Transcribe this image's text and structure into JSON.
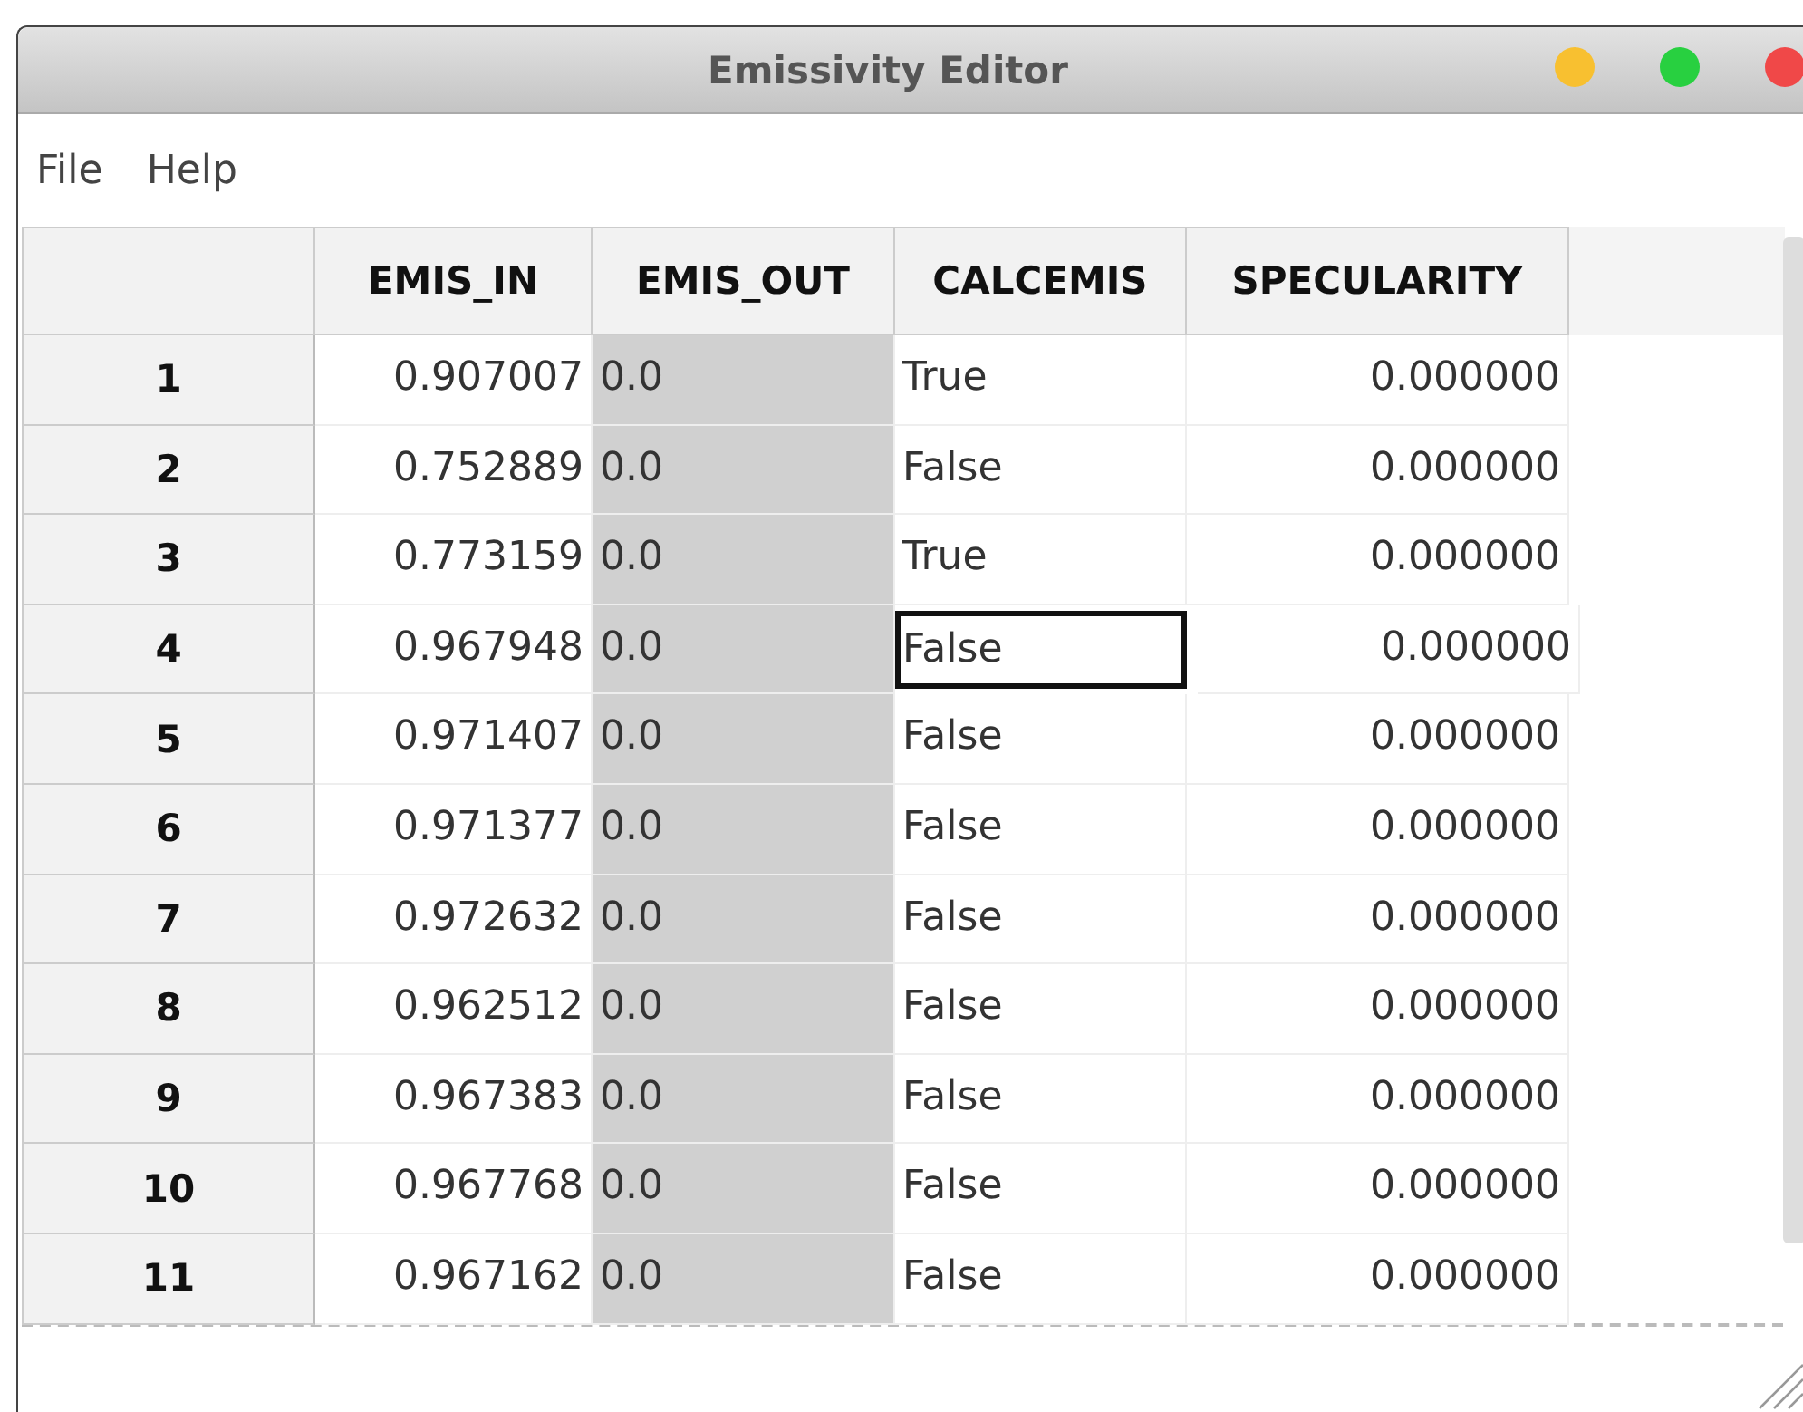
{
  "window": {
    "title": "Emissivity Editor"
  },
  "menu": [
    "File",
    "Help"
  ],
  "table": {
    "columns": [
      {
        "label": "EMIS_IN",
        "read_only": false
      },
      {
        "label": "EMIS_OUT",
        "read_only": true
      },
      {
        "label": "CALCEMIS",
        "read_only": false
      },
      {
        "label": "SPECULARITY",
        "read_only": false
      }
    ],
    "rows": [
      {
        "header": "1",
        "cells": [
          {
            "text": "0.907007",
            "selected": false
          },
          {
            "text": "0.0",
            "selected": false
          },
          {
            "text": "True",
            "selected": false
          },
          {
            "text": "0.000000",
            "selected": false
          }
        ]
      },
      {
        "header": "2",
        "cells": [
          {
            "text": "0.752889",
            "selected": false
          },
          {
            "text": "0.0",
            "selected": false
          },
          {
            "text": "False",
            "selected": false
          },
          {
            "text": "0.000000",
            "selected": false
          }
        ]
      },
      {
        "header": "3",
        "cells": [
          {
            "text": "0.773159",
            "selected": false
          },
          {
            "text": "0.0",
            "selected": false
          },
          {
            "text": "True",
            "selected": false
          },
          {
            "text": "0.000000",
            "selected": false
          }
        ]
      },
      {
        "header": "4",
        "cells": [
          {
            "text": "0.967948",
            "selected": false
          },
          {
            "text": "0.0",
            "selected": false
          },
          {
            "text": "False",
            "selected": true
          },
          {
            "text": "0.000000",
            "selected": false
          }
        ]
      },
      {
        "header": "5",
        "cells": [
          {
            "text": "0.971407",
            "selected": false
          },
          {
            "text": "0.0",
            "selected": false
          },
          {
            "text": "False",
            "selected": false
          },
          {
            "text": "0.000000",
            "selected": false
          }
        ]
      },
      {
        "header": "6",
        "cells": [
          {
            "text": "0.971377",
            "selected": false
          },
          {
            "text": "0.0",
            "selected": false
          },
          {
            "text": "False",
            "selected": false
          },
          {
            "text": "0.000000",
            "selected": false
          }
        ]
      },
      {
        "header": "7",
        "cells": [
          {
            "text": "0.972632",
            "selected": false
          },
          {
            "text": "0.0",
            "selected": false
          },
          {
            "text": "False",
            "selected": false
          },
          {
            "text": "0.000000",
            "selected": false
          }
        ]
      },
      {
        "header": "8",
        "cells": [
          {
            "text": "0.962512",
            "selected": false
          },
          {
            "text": "0.0",
            "selected": false
          },
          {
            "text": "False",
            "selected": false
          },
          {
            "text": "0.000000",
            "selected": false
          }
        ]
      },
      {
        "header": "9",
        "cells": [
          {
            "text": "0.967383",
            "selected": false
          },
          {
            "text": "0.0",
            "selected": false
          },
          {
            "text": "False",
            "selected": false
          },
          {
            "text": "0.000000",
            "selected": false
          }
        ]
      },
      {
        "header": "10",
        "cells": [
          {
            "text": "0.967768",
            "selected": false
          },
          {
            "text": "0.0",
            "selected": false
          },
          {
            "text": "False",
            "selected": false
          },
          {
            "text": "0.000000",
            "selected": false
          }
        ]
      },
      {
        "header": "11",
        "cells": [
          {
            "text": "0.967162",
            "selected": false
          },
          {
            "text": "0.0",
            "selected": false
          },
          {
            "text": "False",
            "selected": false
          },
          {
            "text": "0.000000",
            "selected": false
          }
        ]
      }
    ]
  }
}
